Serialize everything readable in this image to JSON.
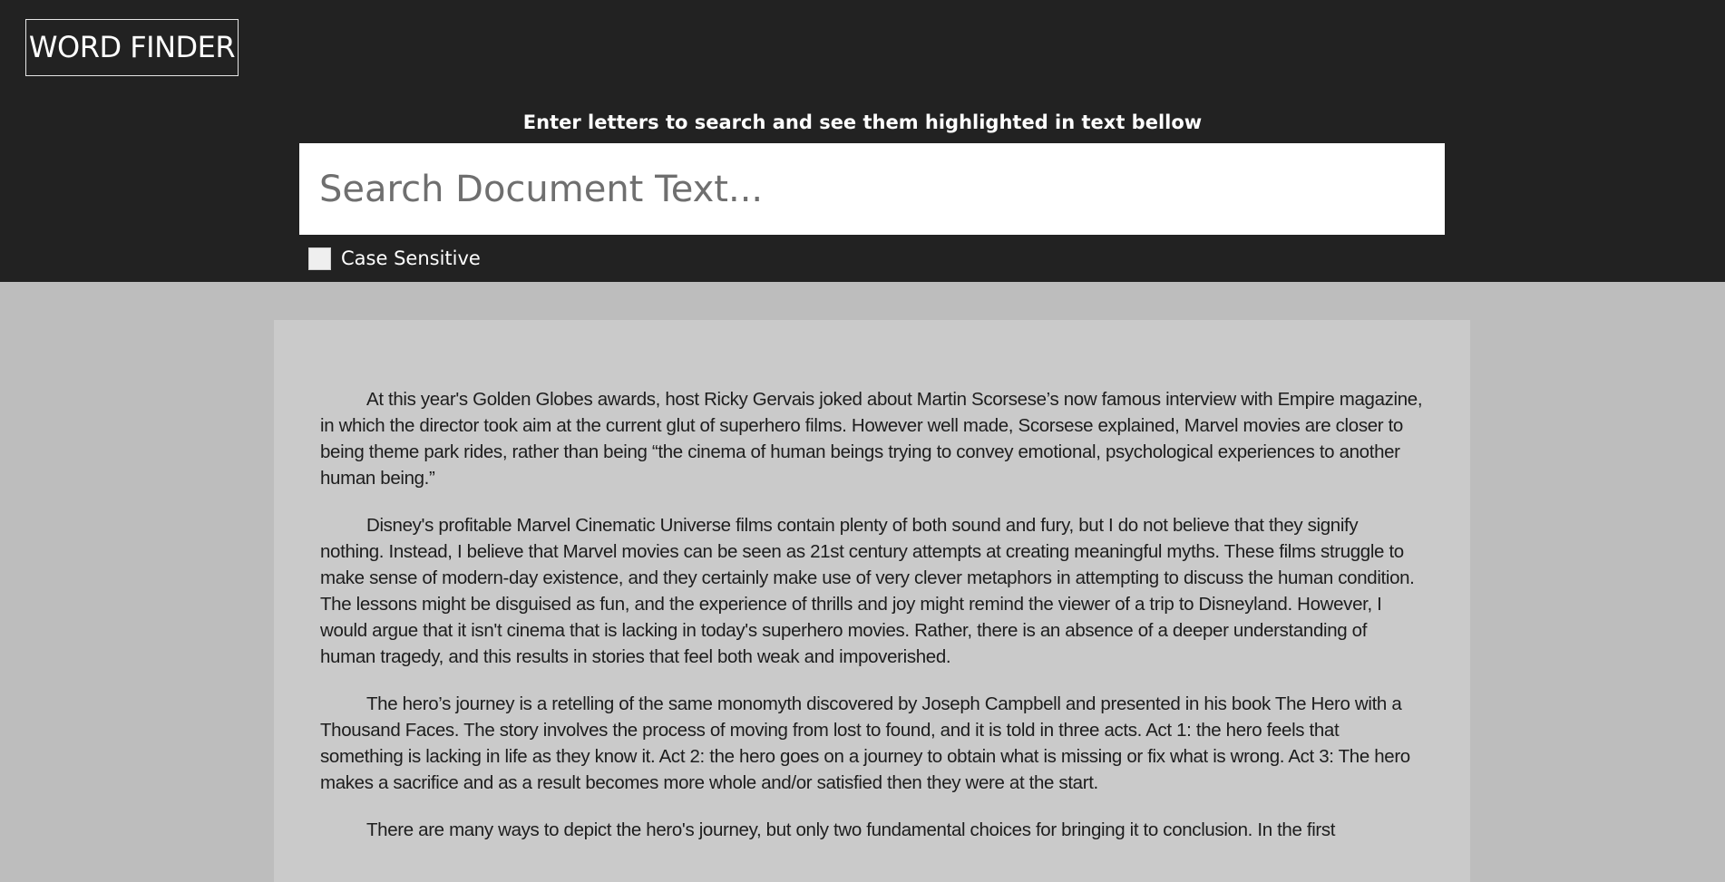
{
  "app": {
    "title": "WORD FINDER"
  },
  "search": {
    "instruction": "Enter letters to search and see them highlighted in text bellow",
    "placeholder": "Search Document Text...",
    "value": "",
    "case_sensitive_label": "Case Sensitive",
    "case_sensitive_checked": false
  },
  "document": {
    "paragraphs": [
      "At this year's Golden Globes awards, host Ricky Gervais joked about Martin Scorsese’s now famous interview with Empire magazine, in which the director took aim at the current glut of superhero films. However well made, Scorsese explained, Marvel movies are closer to being theme park rides, rather than being “the cinema of human beings trying to convey emotional, psychological experiences to another human being.”",
      "Disney's profitable Marvel Cinematic Universe films contain plenty of both sound and fury, but I do not believe that they signify nothing. Instead, I believe that Marvel movies can be seen as 21st century attempts at creating meaningful myths. These films struggle to make sense of modern-day existence, and they certainly make use of very clever metaphors in attempting to discuss the human condition. The lessons might be disguised as fun, and the experience of thrills and joy might remind the viewer of a trip to Disneyland. However, I would argue that it isn't cinema that is lacking in today's superhero movies. Rather, there is an absence of a deeper understanding of human tragedy, and this results in stories that feel both weak and impoverished.",
      "The hero’s journey is a retelling of the same monomyth discovered by Joseph Campbell and presented in his book The Hero with a Thousand Faces. The story involves the process of moving from lost to found, and it is told in three acts. Act 1: the hero feels that something is lacking in life as they know it. Act 2: the hero goes on a journey to obtain what is missing or fix what is wrong. Act 3: The hero makes a sacrifice and as a result becomes more whole and/or satisfied then they were at the start.",
      "There are many ways to depict the hero's journey, but only two fundamental choices for bringing it to conclusion. In the first"
    ]
  },
  "colors": {
    "header_bg": "#222222",
    "page_bg": "#bdbdbd",
    "document_bg": "#cacaca",
    "text": "#1d1d1d"
  }
}
